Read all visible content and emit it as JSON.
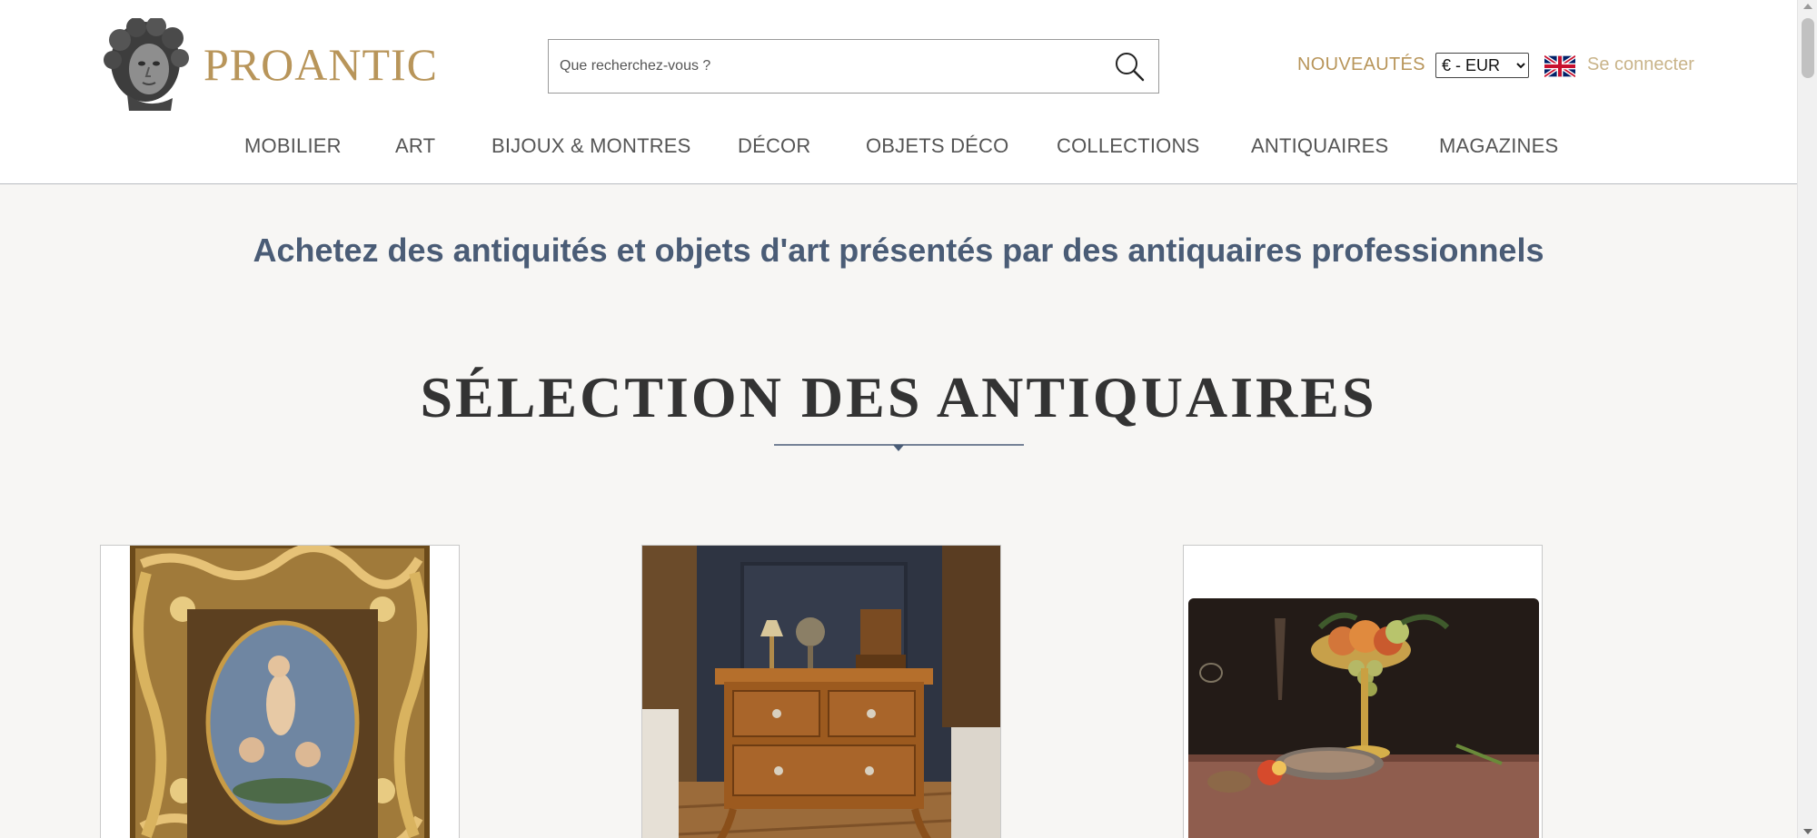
{
  "brand": {
    "name": "PROANTIC",
    "logo_icon": "classical-bust-icon",
    "color": "#b8955a"
  },
  "search": {
    "placeholder": "Que recherchez-vous ?",
    "icon": "search-icon"
  },
  "header_links": {
    "new_label": "NOUVEAUTÉS",
    "login_label": "Se connecter"
  },
  "currency": {
    "selected": "€ - EUR"
  },
  "language_flag": "uk-flag-icon",
  "nav": {
    "items": [
      {
        "label": "MOBILIER"
      },
      {
        "label": "ART"
      },
      {
        "label": "BIJOUX & MONTRES"
      },
      {
        "label": "DÉCOR"
      },
      {
        "label": "OBJETS DÉCO"
      },
      {
        "label": "COLLECTIONS"
      },
      {
        "label": "ANTIQUAIRES"
      },
      {
        "label": "MAGAZINES"
      }
    ]
  },
  "tagline": "Achetez des antiquités et objets d'art présentés par des antiquaires professionnels",
  "section": {
    "title": "SÉLECTION DES ANTIQUAIRES"
  },
  "products": [
    {
      "image": "gilt-frame-painting-image"
    },
    {
      "image": "walnut-commode-image"
    },
    {
      "image": "still-life-painting-image"
    }
  ],
  "colors": {
    "accent_gold": "#b8955a",
    "tagline_blue": "#4a5c76",
    "background": "#f7f6f4"
  }
}
